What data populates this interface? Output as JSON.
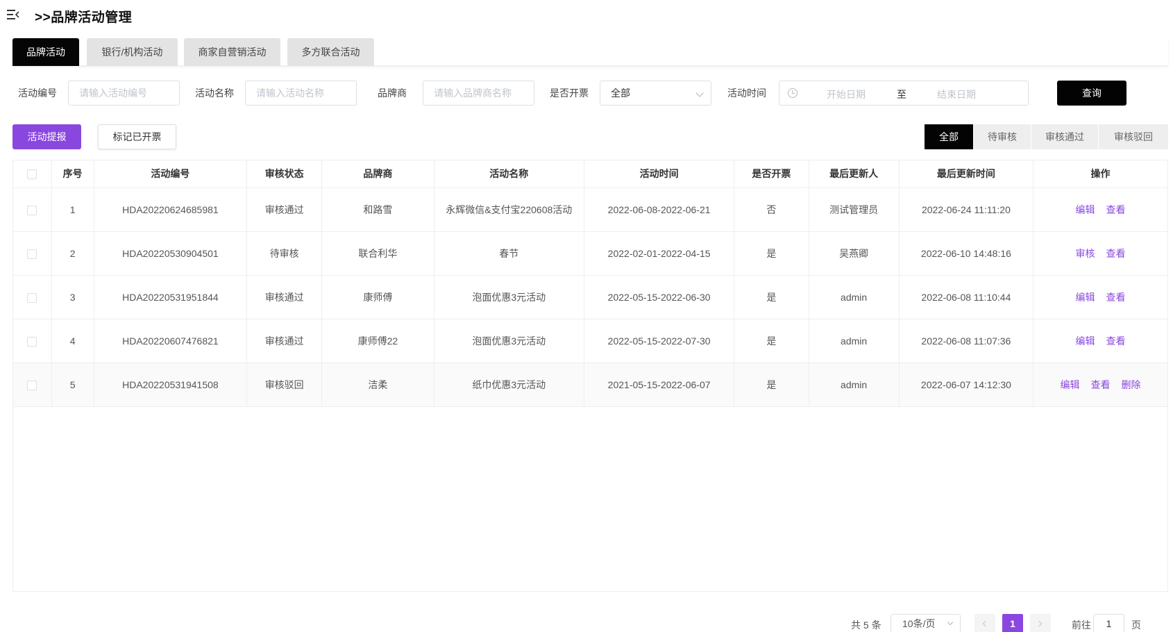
{
  "header": {
    "title": ">>品牌活动管理",
    "menu_icon": "menu-fold-icon"
  },
  "tabs": [
    {
      "label": "品牌活动",
      "active": true
    },
    {
      "label": "银行/机构活动",
      "active": false
    },
    {
      "label": "商家自营销活动",
      "active": false
    },
    {
      "label": "多方联合活动",
      "active": false
    }
  ],
  "filters": {
    "activity_no": {
      "label": "活动编号",
      "placeholder": "请输入活动编号"
    },
    "activity_name": {
      "label": "活动名称",
      "placeholder": "请输入活动名称"
    },
    "brand": {
      "label": "品牌商",
      "placeholder": "请输入品牌商名称"
    },
    "invoice": {
      "label": "是否开票",
      "value": "全部"
    },
    "time": {
      "label": "活动时间",
      "start_placeholder": "开始日期",
      "separator": "至",
      "end_placeholder": "结束日期"
    },
    "query_label": "查询"
  },
  "actions": {
    "remind_label": "活动提报",
    "mark_label": "标记已开票"
  },
  "status_filter": [
    {
      "label": "全部",
      "active": true
    },
    {
      "label": "待审核",
      "active": false
    },
    {
      "label": "审核通过",
      "active": false
    },
    {
      "label": "审核驳回",
      "active": false
    }
  ],
  "table": {
    "columns": [
      "序号",
      "活动编号",
      "审核状态",
      "品牌商",
      "活动名称",
      "活动时间",
      "是否开票",
      "最后更新人",
      "最后更新时间",
      "操作"
    ],
    "rows": [
      {
        "no": "1",
        "code": "HDA20220624685981",
        "status": "审核通过",
        "brand": "和路雪",
        "name": "永辉微信&支付宝220608活动",
        "time": "2022-06-08-2022-06-21",
        "invoice": "否",
        "updater": "测试管理员",
        "updated": "2022-06-24 11:11:20",
        "ops": [
          "编辑",
          "查看"
        ]
      },
      {
        "no": "2",
        "code": "HDA20220530904501",
        "status": "待审核",
        "brand": "联合利华",
        "name": "春节",
        "time": "2022-02-01-2022-04-15",
        "invoice": "是",
        "updater": "吴燕卿",
        "updated": "2022-06-10 14:48:16",
        "ops": [
          "审核",
          "查看"
        ]
      },
      {
        "no": "3",
        "code": "HDA20220531951844",
        "status": "审核通过",
        "brand": "康师傅",
        "name": "泡面优惠3元活动",
        "time": "2022-05-15-2022-06-30",
        "invoice": "是",
        "updater": "admin",
        "updated": "2022-06-08 11:10:44",
        "ops": [
          "编辑",
          "查看"
        ]
      },
      {
        "no": "4",
        "code": "HDA20220607476821",
        "status": "审核通过",
        "brand": "康师傅22",
        "name": "泡面优惠3元活动",
        "time": "2022-05-15-2022-07-30",
        "invoice": "是",
        "updater": "admin",
        "updated": "2022-06-08 11:07:36",
        "ops": [
          "编辑",
          "查看"
        ]
      },
      {
        "no": "5",
        "code": "HDA20220531941508",
        "status": "审核驳回",
        "brand": "洁柔",
        "name": "纸巾优惠3元活动",
        "time": "2021-05-15-2022-06-07",
        "invoice": "是",
        "updater": "admin",
        "updated": "2022-06-07 14:12:30",
        "ops": [
          "编辑",
          "查看",
          "删除"
        ]
      }
    ]
  },
  "pagination": {
    "total": "共 5 条",
    "page_size": "10条/页",
    "current": "1",
    "goto_label": "前往",
    "goto_value": "1",
    "unit": "页"
  },
  "colors": {
    "accent": "#8a47e0",
    "dark": "#030303"
  }
}
